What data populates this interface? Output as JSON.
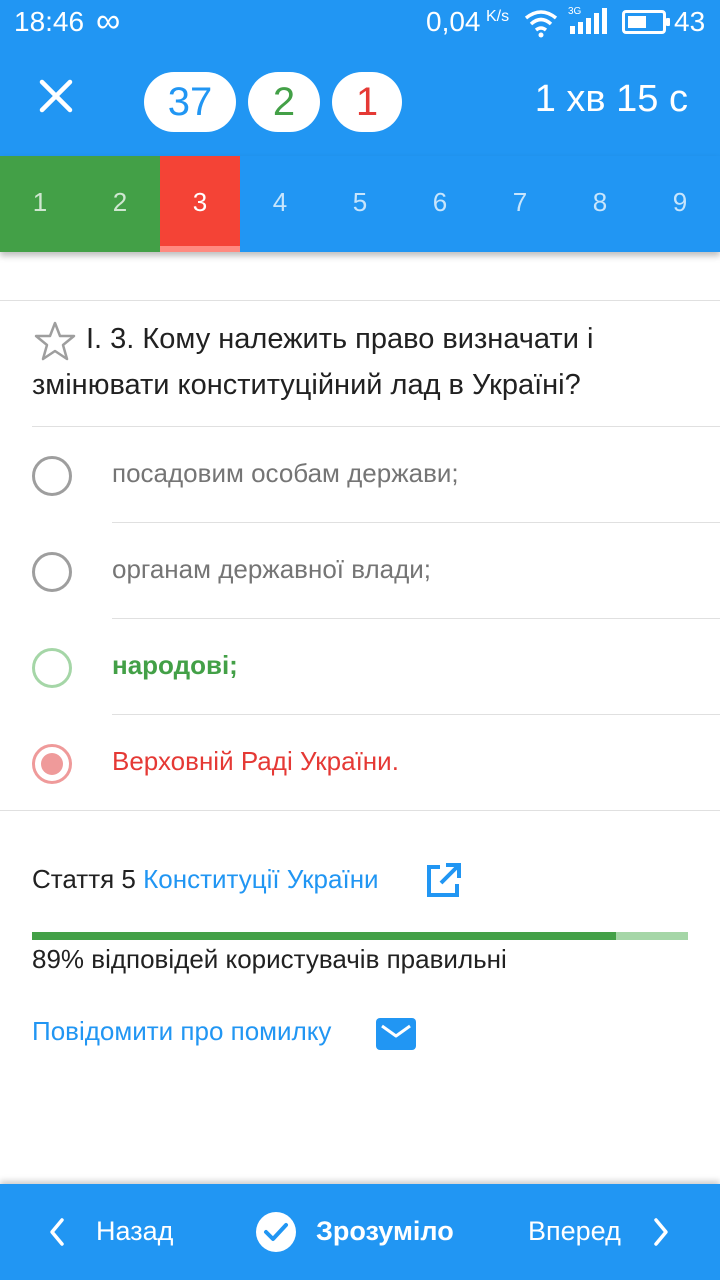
{
  "status_bar": {
    "time": "18:46",
    "infinity": "∞",
    "network_speed": "0,04",
    "network_unit": "K/s",
    "signal_type": "3G",
    "battery": "43"
  },
  "header": {
    "close_icon": "close-icon",
    "total_count": "37",
    "correct_count": "2",
    "wrong_count": "1",
    "timer": "1 хв 15 с"
  },
  "question_nav": [
    {
      "label": "1",
      "state": "correct"
    },
    {
      "label": "2",
      "state": "correct"
    },
    {
      "label": "3",
      "state": "wrong"
    },
    {
      "label": "4",
      "state": "unanswered"
    },
    {
      "label": "5",
      "state": "unanswered"
    },
    {
      "label": "6",
      "state": "unanswered"
    },
    {
      "label": "7",
      "state": "unanswered"
    },
    {
      "label": "8",
      "state": "unanswered"
    },
    {
      "label": "9",
      "state": "unanswered"
    }
  ],
  "question": {
    "text": "І. 3. Кому належить право визначати і змінювати конституційний лад в Україні?",
    "answers": [
      {
        "text": "посадовим особам держави;",
        "state": "normal"
      },
      {
        "text": "органам державної влади;",
        "state": "normal"
      },
      {
        "text": "народові;",
        "state": "correct"
      },
      {
        "text": "Верховній Раді України.",
        "state": "selected-wrong"
      }
    ]
  },
  "info": {
    "source_prefix": "Стаття 5",
    "source_link": "Конституції України",
    "correct_ratio": 0.89,
    "stats_text": "89% відповідей користувачів правильні",
    "report_label": "Повідомити про помилку"
  },
  "bottom_nav": {
    "back_label": "Назад",
    "ok_label": "Зрозуміло",
    "next_label": "Вперед"
  },
  "colors": {
    "primary": "#2196F3",
    "correct": "#43A047",
    "wrong": "#F44336"
  }
}
